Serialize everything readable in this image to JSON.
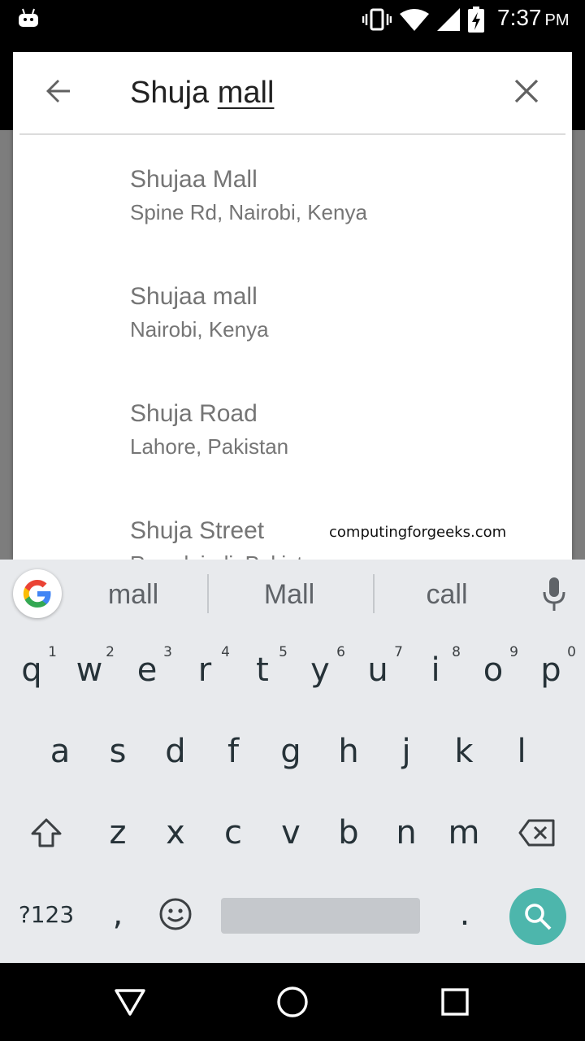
{
  "status_bar": {
    "time": "7:37",
    "ampm": "PM",
    "icons": [
      "android-icon",
      "vibrate-icon",
      "wifi-icon",
      "signal-icon",
      "battery-charging-icon"
    ]
  },
  "search": {
    "query_prefix": "Shuja ",
    "query_underlined": "mall",
    "back_icon": "arrow-back-icon",
    "clear_icon": "close-icon"
  },
  "results": [
    {
      "title": "Shujaa Mall",
      "subtitle": "Spine Rd, Nairobi, Kenya"
    },
    {
      "title": "Shujaa mall",
      "subtitle": "Nairobi, Kenya"
    },
    {
      "title": "Shuja Road",
      "subtitle": "Lahore, Pakistan"
    },
    {
      "title": "Shuja Street",
      "subtitle": "Rawalpindi, Pakistan"
    }
  ],
  "watermark": "computingforgeeks.com",
  "suggestions": {
    "items": [
      "mall",
      "Mall",
      "call"
    ],
    "google_icon": "google-g-icon",
    "mic_icon": "mic-icon"
  },
  "keyboard": {
    "row1": [
      {
        "key": "q",
        "hint": "1"
      },
      {
        "key": "w",
        "hint": "2"
      },
      {
        "key": "e",
        "hint": "3"
      },
      {
        "key": "r",
        "hint": "4"
      },
      {
        "key": "t",
        "hint": "5"
      },
      {
        "key": "y",
        "hint": "6"
      },
      {
        "key": "u",
        "hint": "7"
      },
      {
        "key": "i",
        "hint": "8"
      },
      {
        "key": "o",
        "hint": "9"
      },
      {
        "key": "p",
        "hint": "0"
      }
    ],
    "row2": [
      "a",
      "s",
      "d",
      "f",
      "g",
      "h",
      "j",
      "k",
      "l"
    ],
    "row3": [
      "z",
      "x",
      "c",
      "v",
      "b",
      "n",
      "m"
    ],
    "symbols_label": "?123",
    "comma": ",",
    "period": ".",
    "accent_color": "#4db6ac"
  },
  "colors": {
    "status_bar": "#000000",
    "keyboard_bg": "#e8eaed",
    "result_text": "#757575"
  }
}
